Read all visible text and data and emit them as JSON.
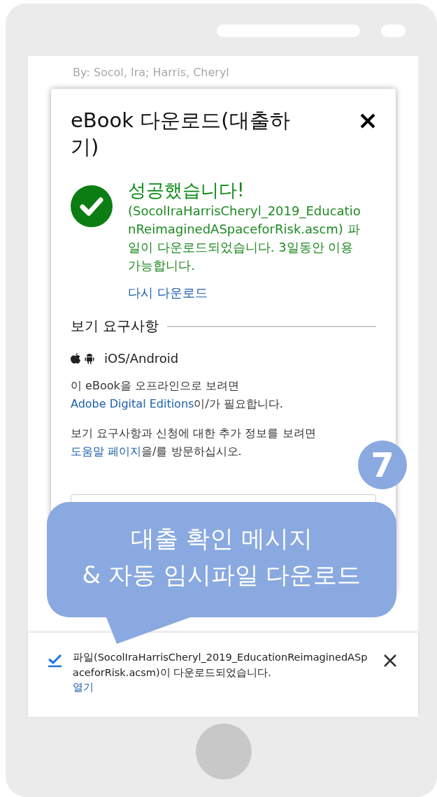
{
  "page": {
    "byline": "By: Socol, Ira; Harris, Cheryl"
  },
  "dialog": {
    "title": "eBook 다운로드(대출하기)",
    "success_title": "성공했습니다!",
    "success_message": "(SocolIraHarrisCheryl_2019_EducationReimaginedASpaceforRisk.ascm) 파일이 다운로드되었습니다. 3일동안 이용 가능합니다.",
    "redownload_link": "다시 다운로드",
    "section_title": "보기 요구사항",
    "platform": "iOS/Android",
    "paragraphs": [
      {
        "before": "이 eBook을 오프라인으로 보려면",
        "link": "Adobe Digital Editions",
        "after": "이/가 필요합니다."
      },
      {
        "before": "보기 요구사항과 신청에 대한 추가 정보를 보려면",
        "link": "도움말 페이지",
        "after": "을/를 방문하십시오."
      }
    ]
  },
  "step_badge": "7",
  "callout": [
    "대출 확인 메시지",
    "& 자동 임시파일 다운로드"
  ],
  "download_bar": {
    "message": "파일(SocolIraHarrisCheryl_2019_EducationReimaginedASpaceforRisk.acsm)이 다운로드되었습니다.",
    "open_link": "열기"
  }
}
